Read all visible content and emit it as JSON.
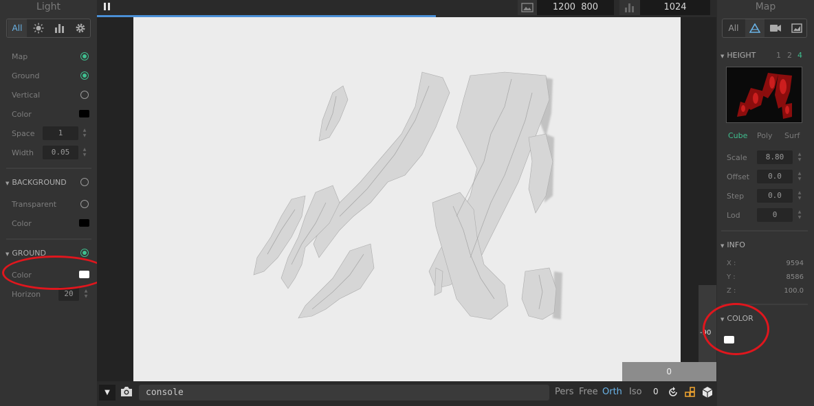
{
  "left_panel": {
    "title": "Light",
    "tabs": {
      "all": "All",
      "icons": [
        "sun-icon",
        "bar-chart-icon",
        "gear-icon"
      ]
    },
    "light": {
      "map": "Map",
      "ground": "Ground",
      "vertical": "Vertical",
      "color": "Color",
      "space_label": "Space",
      "space_value": "1",
      "width_label": "Width",
      "width_value": "0.05"
    },
    "background": {
      "header": "BACKGROUND",
      "transparent": "Transparent",
      "color": "Color"
    },
    "ground": {
      "header": "GROUND",
      "color": "Color",
      "horizon_label": "Horizon",
      "horizon_value": "20"
    }
  },
  "top_bar": {
    "resolution_w": "1200",
    "resolution_h": "800",
    "samples": "1024"
  },
  "viewport": {
    "angle_readout": "-90",
    "bottom_readout": "0"
  },
  "bottom_bar": {
    "console_text": "console",
    "views": [
      "Pers",
      "Free",
      "Orth",
      "Iso"
    ],
    "selected_view": "Orth",
    "counter": "0"
  },
  "right_panel": {
    "title": "Map",
    "tabs": {
      "all": "All"
    },
    "height": {
      "header": "HEIGHT",
      "levels": [
        "1",
        "2",
        "4"
      ],
      "modes": [
        "Cube",
        "Poly",
        "Surf"
      ],
      "scale_label": "Scale",
      "scale_value": "8.80",
      "offset_label": "Offset",
      "offset_value": "0.0",
      "step_label": "Step",
      "step_value": "0.0",
      "lod_label": "Lod",
      "lod_value": "0"
    },
    "info": {
      "header": "INFO",
      "x_label": "X :",
      "x_value": "9594",
      "y_label": "Y :",
      "y_value": "8586",
      "z_label": "Z :",
      "z_value": "100.0"
    },
    "color": {
      "header": "COLOR"
    }
  },
  "colors": {
    "accent_blue": "#6ab4e8",
    "accent_green": "#3fbf8f",
    "annotation_red": "#e0161d",
    "ground_color": "#ffffff",
    "background_color": "#000000"
  }
}
